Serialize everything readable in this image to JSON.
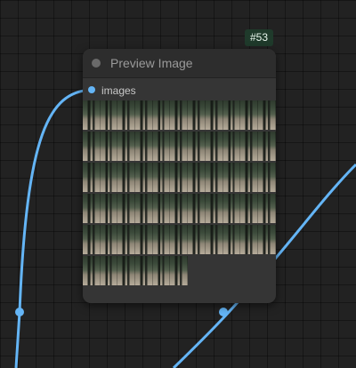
{
  "node": {
    "id_badge": "#53",
    "title": "Preview Image",
    "input_label": "images"
  },
  "colors": {
    "link": "#64b5f6",
    "badge_bg": "#1f3a2b",
    "node_bg": "#353535"
  },
  "preview": {
    "rows": 6,
    "columns": 11,
    "last_row_count": 6
  }
}
